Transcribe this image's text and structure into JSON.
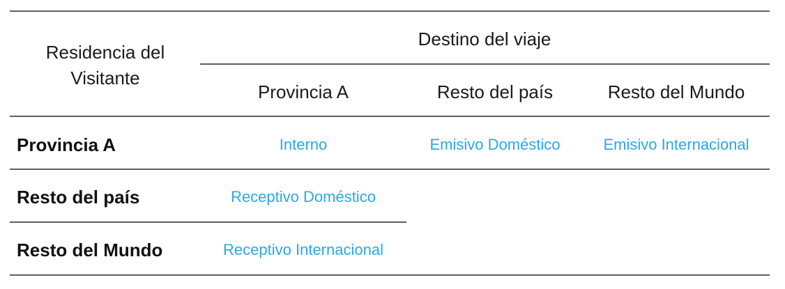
{
  "table": {
    "corner_header_line1": "Residencia del",
    "corner_header_line2": "Visitante",
    "group_header": "Destino del viaje",
    "columns": [
      "Provincia A",
      "Resto del país",
      "Resto del Mundo"
    ],
    "rows": [
      {
        "label": "Provincia A",
        "cells": [
          "Interno",
          "Emisivo Doméstico",
          "Emisivo Internacional"
        ]
      },
      {
        "label": "Resto del país",
        "cells": [
          "Receptivo Doméstico",
          "",
          ""
        ]
      },
      {
        "label": "Resto del Mundo",
        "cells": [
          "Receptivo Internacional",
          "",
          ""
        ]
      }
    ]
  },
  "colors": {
    "cell_text": "#2aa9e0",
    "rule": "#5f5f5f",
    "header_text": "#1a1a1a"
  }
}
